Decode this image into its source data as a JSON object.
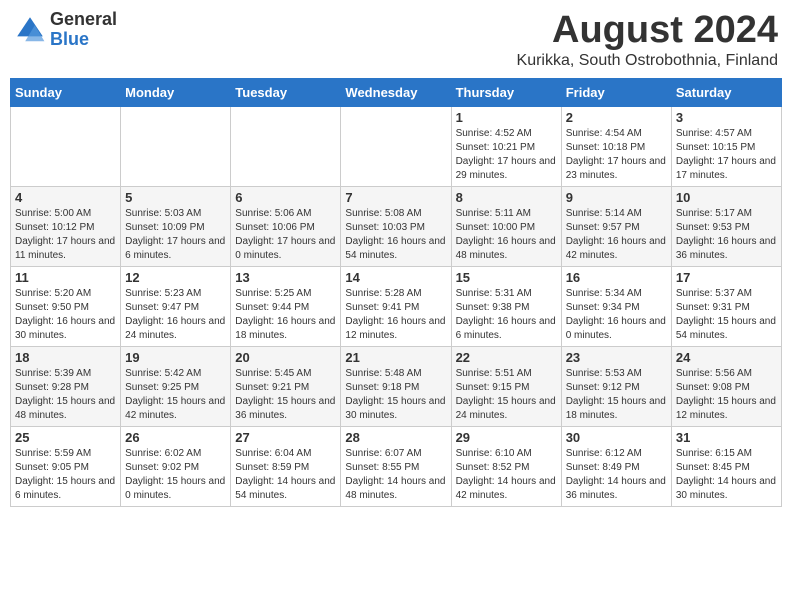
{
  "header": {
    "logo_general": "General",
    "logo_blue": "Blue",
    "month_title": "August 2024",
    "subtitle": "Kurikka, South Ostrobothnia, Finland"
  },
  "weekdays": [
    "Sunday",
    "Monday",
    "Tuesday",
    "Wednesday",
    "Thursday",
    "Friday",
    "Saturday"
  ],
  "weeks": [
    [
      {
        "day": "",
        "info": ""
      },
      {
        "day": "",
        "info": ""
      },
      {
        "day": "",
        "info": ""
      },
      {
        "day": "",
        "info": ""
      },
      {
        "day": "1",
        "info": "Sunrise: 4:52 AM\nSunset: 10:21 PM\nDaylight: 17 hours\nand 29 minutes."
      },
      {
        "day": "2",
        "info": "Sunrise: 4:54 AM\nSunset: 10:18 PM\nDaylight: 17 hours\nand 23 minutes."
      },
      {
        "day": "3",
        "info": "Sunrise: 4:57 AM\nSunset: 10:15 PM\nDaylight: 17 hours\nand 17 minutes."
      }
    ],
    [
      {
        "day": "4",
        "info": "Sunrise: 5:00 AM\nSunset: 10:12 PM\nDaylight: 17 hours\nand 11 minutes."
      },
      {
        "day": "5",
        "info": "Sunrise: 5:03 AM\nSunset: 10:09 PM\nDaylight: 17 hours\nand 6 minutes."
      },
      {
        "day": "6",
        "info": "Sunrise: 5:06 AM\nSunset: 10:06 PM\nDaylight: 17 hours\nand 0 minutes."
      },
      {
        "day": "7",
        "info": "Sunrise: 5:08 AM\nSunset: 10:03 PM\nDaylight: 16 hours\nand 54 minutes."
      },
      {
        "day": "8",
        "info": "Sunrise: 5:11 AM\nSunset: 10:00 PM\nDaylight: 16 hours\nand 48 minutes."
      },
      {
        "day": "9",
        "info": "Sunrise: 5:14 AM\nSunset: 9:57 PM\nDaylight: 16 hours\nand 42 minutes."
      },
      {
        "day": "10",
        "info": "Sunrise: 5:17 AM\nSunset: 9:53 PM\nDaylight: 16 hours\nand 36 minutes."
      }
    ],
    [
      {
        "day": "11",
        "info": "Sunrise: 5:20 AM\nSunset: 9:50 PM\nDaylight: 16 hours\nand 30 minutes."
      },
      {
        "day": "12",
        "info": "Sunrise: 5:23 AM\nSunset: 9:47 PM\nDaylight: 16 hours\nand 24 minutes."
      },
      {
        "day": "13",
        "info": "Sunrise: 5:25 AM\nSunset: 9:44 PM\nDaylight: 16 hours\nand 18 minutes."
      },
      {
        "day": "14",
        "info": "Sunrise: 5:28 AM\nSunset: 9:41 PM\nDaylight: 16 hours\nand 12 minutes."
      },
      {
        "day": "15",
        "info": "Sunrise: 5:31 AM\nSunset: 9:38 PM\nDaylight: 16 hours\nand 6 minutes."
      },
      {
        "day": "16",
        "info": "Sunrise: 5:34 AM\nSunset: 9:34 PM\nDaylight: 16 hours\nand 0 minutes."
      },
      {
        "day": "17",
        "info": "Sunrise: 5:37 AM\nSunset: 9:31 PM\nDaylight: 15 hours\nand 54 minutes."
      }
    ],
    [
      {
        "day": "18",
        "info": "Sunrise: 5:39 AM\nSunset: 9:28 PM\nDaylight: 15 hours\nand 48 minutes."
      },
      {
        "day": "19",
        "info": "Sunrise: 5:42 AM\nSunset: 9:25 PM\nDaylight: 15 hours\nand 42 minutes."
      },
      {
        "day": "20",
        "info": "Sunrise: 5:45 AM\nSunset: 9:21 PM\nDaylight: 15 hours\nand 36 minutes."
      },
      {
        "day": "21",
        "info": "Sunrise: 5:48 AM\nSunset: 9:18 PM\nDaylight: 15 hours\nand 30 minutes."
      },
      {
        "day": "22",
        "info": "Sunrise: 5:51 AM\nSunset: 9:15 PM\nDaylight: 15 hours\nand 24 minutes."
      },
      {
        "day": "23",
        "info": "Sunrise: 5:53 AM\nSunset: 9:12 PM\nDaylight: 15 hours\nand 18 minutes."
      },
      {
        "day": "24",
        "info": "Sunrise: 5:56 AM\nSunset: 9:08 PM\nDaylight: 15 hours\nand 12 minutes."
      }
    ],
    [
      {
        "day": "25",
        "info": "Sunrise: 5:59 AM\nSunset: 9:05 PM\nDaylight: 15 hours\nand 6 minutes."
      },
      {
        "day": "26",
        "info": "Sunrise: 6:02 AM\nSunset: 9:02 PM\nDaylight: 15 hours\nand 0 minutes."
      },
      {
        "day": "27",
        "info": "Sunrise: 6:04 AM\nSunset: 8:59 PM\nDaylight: 14 hours\nand 54 minutes."
      },
      {
        "day": "28",
        "info": "Sunrise: 6:07 AM\nSunset: 8:55 PM\nDaylight: 14 hours\nand 48 minutes."
      },
      {
        "day": "29",
        "info": "Sunrise: 6:10 AM\nSunset: 8:52 PM\nDaylight: 14 hours\nand 42 minutes."
      },
      {
        "day": "30",
        "info": "Sunrise: 6:12 AM\nSunset: 8:49 PM\nDaylight: 14 hours\nand 36 minutes."
      },
      {
        "day": "31",
        "info": "Sunrise: 6:15 AM\nSunset: 8:45 PM\nDaylight: 14 hours\nand 30 minutes."
      }
    ]
  ]
}
